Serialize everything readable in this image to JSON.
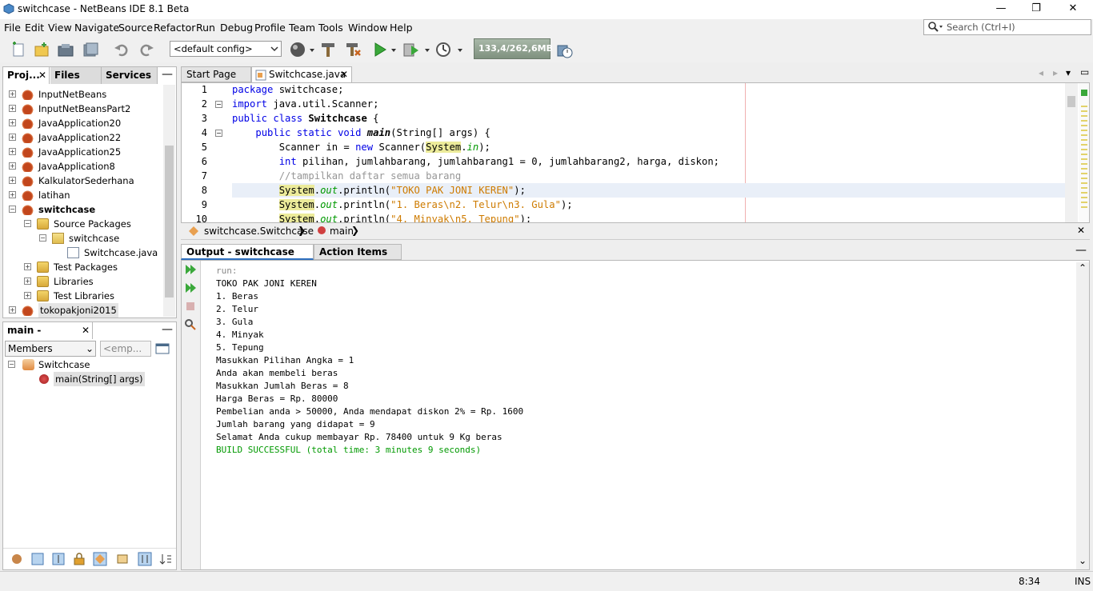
{
  "window": {
    "title": "switchcase - NetBeans IDE 8.1 Beta",
    "controls": [
      "—",
      "❐",
      "✕"
    ]
  },
  "menu": [
    "File",
    "Edit",
    "View",
    "Navigate",
    "Source",
    "Refactor",
    "Run",
    "Debug",
    "Profile",
    "Team",
    "Tools",
    "Window",
    "Help"
  ],
  "search": {
    "placeholder": "Search (Ctrl+I)"
  },
  "toolbar": {
    "config_value": "<default config>",
    "memory": "133,4/262,6MB"
  },
  "projects_panel": {
    "tabs": [
      "Proj...",
      "Files",
      "Services"
    ],
    "tree": [
      {
        "label": "InputNetBeans",
        "level": 0,
        "icon": "cup",
        "exp": "+"
      },
      {
        "label": "InputNetBeansPart2",
        "level": 0,
        "icon": "cup",
        "exp": "+"
      },
      {
        "label": "JavaApplication20",
        "level": 0,
        "icon": "cup",
        "exp": "+"
      },
      {
        "label": "JavaApplication22",
        "level": 0,
        "icon": "cup",
        "exp": "+"
      },
      {
        "label": "JavaApplication25",
        "level": 0,
        "icon": "cup",
        "exp": "+"
      },
      {
        "label": "JavaApplication8",
        "level": 0,
        "icon": "cup",
        "exp": "+"
      },
      {
        "label": "KalkulatorSederhana",
        "level": 0,
        "icon": "cup",
        "exp": "+"
      },
      {
        "label": "latihan",
        "level": 0,
        "icon": "cup",
        "exp": "+"
      },
      {
        "label": "switchcase",
        "level": 0,
        "icon": "cup",
        "exp": "−",
        "bold": true
      },
      {
        "label": "Source Packages",
        "level": 1,
        "icon": "folder",
        "exp": "−"
      },
      {
        "label": "switchcase",
        "level": 2,
        "icon": "pkg",
        "exp": "−"
      },
      {
        "label": "Switchcase.java",
        "level": 3,
        "icon": "jfile",
        "exp": ""
      },
      {
        "label": "Test Packages",
        "level": 1,
        "icon": "folder",
        "exp": "+"
      },
      {
        "label": "Libraries",
        "level": 1,
        "icon": "folder",
        "exp": "+"
      },
      {
        "label": "Test Libraries",
        "level": 1,
        "icon": "folder",
        "exp": "+"
      },
      {
        "label": "tokopakjoni2015",
        "level": 0,
        "icon": "cup",
        "exp": "+",
        "selected": true
      }
    ]
  },
  "navigator": {
    "title": "main - Navigator",
    "filter": "Members",
    "filter2": "<emp...",
    "tree": [
      {
        "label": "Switchcase",
        "level": 0
      },
      {
        "label": "main(String[] args)",
        "level": 1
      }
    ]
  },
  "editor": {
    "tabs": [
      "Start Page",
      "Switchcase.java"
    ],
    "lines": [
      {
        "n": "1",
        "html": "<span class=\"kw\">package</span> switchcase;"
      },
      {
        "n": "2",
        "html": "<span class=\"kw\">import</span> java.util.Scanner;"
      },
      {
        "n": "3",
        "html": "<span class=\"kw\">public class</span> <b>Switchcase</b> {"
      },
      {
        "n": "4",
        "html": "    <span class=\"kw\">public static void</span> <b><i>main</i></b>(String[] args) {"
      },
      {
        "n": "5",
        "html": "        Scanner in = <span class=\"kw\">new</span> Scanner(<span class=\"hl\">System</span>.<span class=\"it\">in</span>);"
      },
      {
        "n": "6",
        "html": "        <span class=\"kw\">int</span> pilihan, jumlahbarang, jumlahbarang1 = 0, jumlahbarang2, harga, diskon;"
      },
      {
        "n": "7",
        "html": "        <span class=\"cm\">//tampilkan daftar semua barang</span>"
      },
      {
        "n": "8",
        "html": "        <span class=\"hl\">System</span>.<span class=\"it\">out</span>.println(<span class=\"str\">\"TOKO PAK JONI KEREN\"</span>);"
      },
      {
        "n": "9",
        "html": "        <span class=\"hl\">System</span>.<span class=\"it\">out</span>.println(<span class=\"str\">\"1. Beras\\n2. Telur\\n3. Gula\"</span>);"
      },
      {
        "n": "10",
        "html": "        <span class=\"hl\">System</span>.<span class=\"it\">out</span>.println(<span class=\"str\">\"4. Minyak\\n5. Tepung\"</span>);"
      }
    ],
    "breadcrumb": [
      "switchcase.Switchcase",
      "main"
    ]
  },
  "output": {
    "tabs": [
      "Output - switchcase (run)",
      "Action Items"
    ],
    "lines": [
      {
        "text": "run:",
        "color": "#8a8a8a"
      },
      {
        "text": "TOKO PAK JONI KEREN",
        "color": "#000000"
      },
      {
        "text": "1. Beras",
        "color": "#000000"
      },
      {
        "text": "2. Telur",
        "color": "#000000"
      },
      {
        "text": "3. Gula",
        "color": "#000000"
      },
      {
        "text": "4. Minyak",
        "color": "#000000"
      },
      {
        "text": "5. Tepung",
        "color": "#000000"
      },
      {
        "text": "Masukkan Pilihan Angka = 1",
        "color": "#000000"
      },
      {
        "text": "Anda akan membeli beras",
        "color": "#000000"
      },
      {
        "text": "Masukkan Jumlah Beras = 8",
        "color": "#000000"
      },
      {
        "text": "Harga Beras = Rp. 80000",
        "color": "#000000"
      },
      {
        "text": "Pembelian anda > 50000, Anda mendapat diskon 2% = Rp. 1600",
        "color": "#000000"
      },
      {
        "text": "Jumlah barang yang didapat = 9",
        "color": "#000000"
      },
      {
        "text": "Selamat Anda cukup membayar Rp. 78400 untuk 9 Kg beras",
        "color": "#000000"
      },
      {
        "text": "BUILD SUCCESSFUL (total time: 3 minutes 9 seconds)",
        "color": "#009900"
      }
    ]
  },
  "status": {
    "position": "8:34",
    "mode": "INS"
  },
  "colors": {
    "accent": "#2e6fbf",
    "success": "#009900"
  }
}
